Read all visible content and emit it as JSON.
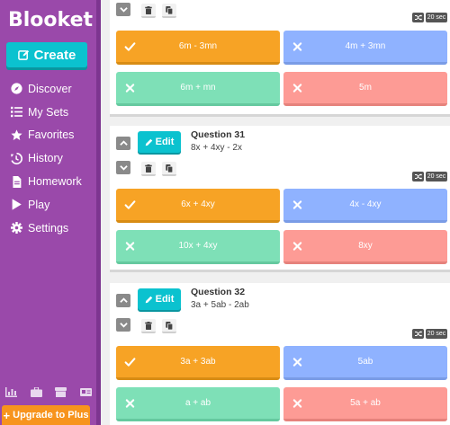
{
  "sidebar": {
    "logo": "Blooket",
    "create_label": "Create",
    "items": [
      {
        "label": "Discover",
        "icon": "compass-icon"
      },
      {
        "label": "My Sets",
        "icon": "list-icon"
      },
      {
        "label": "Favorites",
        "icon": "star-icon"
      },
      {
        "label": "History",
        "icon": "history-icon"
      },
      {
        "label": "Homework",
        "icon": "document-icon"
      },
      {
        "label": "Play",
        "icon": "play-icon"
      },
      {
        "label": "Settings",
        "icon": "gear-icon"
      }
    ],
    "bottom_icons": [
      "stats-icon",
      "briefcase-icon",
      "store-icon",
      "news-icon"
    ],
    "upgrade_label": "Upgrade to Plus"
  },
  "questions": [
    {
      "title": "",
      "text": "",
      "time": "20 sec",
      "answers": [
        {
          "text": "6m - 3mn",
          "correct": true
        },
        {
          "text": "4m + 3mn",
          "correct": false
        },
        {
          "text": "6m + mn",
          "correct": false
        },
        {
          "text": "5m",
          "correct": false
        }
      ]
    },
    {
      "title": "Question 31",
      "text": "8x + 4xy - 2x",
      "edit_label": "Edit",
      "time": "20 sec",
      "answers": [
        {
          "text": "6x + 4xy",
          "correct": true
        },
        {
          "text": "4x - 4xy",
          "correct": false
        },
        {
          "text": "10x + 4xy",
          "correct": false
        },
        {
          "text": "8xy",
          "correct": false
        }
      ]
    },
    {
      "title": "Question 32",
      "text": "3a + 5ab - 2ab",
      "edit_label": "Edit",
      "time": "20 sec",
      "answers": [
        {
          "text": "3a + 3ab",
          "correct": true
        },
        {
          "text": "5ab",
          "correct": false
        },
        {
          "text": "a + ab",
          "correct": false
        },
        {
          "text": "5a + ab",
          "correct": false
        }
      ]
    }
  ],
  "colors": {
    "sidebar": "#9a49aa",
    "accent": "#0bc2cf",
    "upgrade": "#f7941d",
    "answer_1": "#f7a325",
    "answer_2": "#8fb2ff",
    "answer_3": "#7ee0b7",
    "answer_4": "#fd9b95"
  }
}
